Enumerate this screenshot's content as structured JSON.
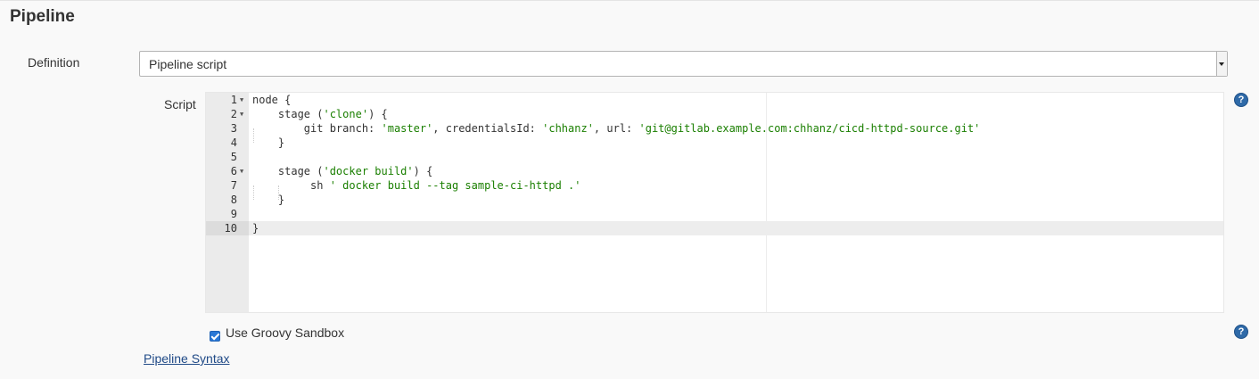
{
  "section": {
    "title": "Pipeline"
  },
  "definition": {
    "label": "Definition",
    "selected": "Pipeline script"
  },
  "script": {
    "label": "Script",
    "active_line": 10,
    "lines": [
      {
        "num": "1",
        "fold": true
      },
      {
        "num": "2",
        "fold": true
      },
      {
        "num": "3",
        "fold": false
      },
      {
        "num": "4",
        "fold": false
      },
      {
        "num": "5",
        "fold": false
      },
      {
        "num": "6",
        "fold": true
      },
      {
        "num": "7",
        "fold": false
      },
      {
        "num": "8",
        "fold": false
      },
      {
        "num": "9",
        "fold": false
      },
      {
        "num": "10",
        "fold": false
      }
    ],
    "tokens": {
      "l1": "node {",
      "l2a": "    stage (",
      "l2s": "'clone'",
      "l2b": ") {",
      "l3a": "        git branch: ",
      "l3s1": "'master'",
      "l3b": ", credentialsId: ",
      "l3s2": "'chhanz'",
      "l3c": ", url: ",
      "l3s3": "'git@gitlab.example.com:chhanz/cicd-httpd-source.git'",
      "l4": "    }",
      "l6a": "    stage (",
      "l6s": "'docker build'",
      "l6b": ") {",
      "l7a": "         sh ",
      "l7s": "' docker build --tag sample-ci-httpd .'",
      "l8": "    }",
      "l10": "}"
    }
  },
  "sandbox": {
    "label": "Use Groovy Sandbox",
    "checked": true
  },
  "syntax_link": {
    "label": "Pipeline Syntax"
  },
  "icons": {
    "help": "help-icon",
    "help_glyph": "?"
  },
  "colors": {
    "string": "#1a7f00",
    "link": "#204a87",
    "help": "#2f6aa8"
  }
}
